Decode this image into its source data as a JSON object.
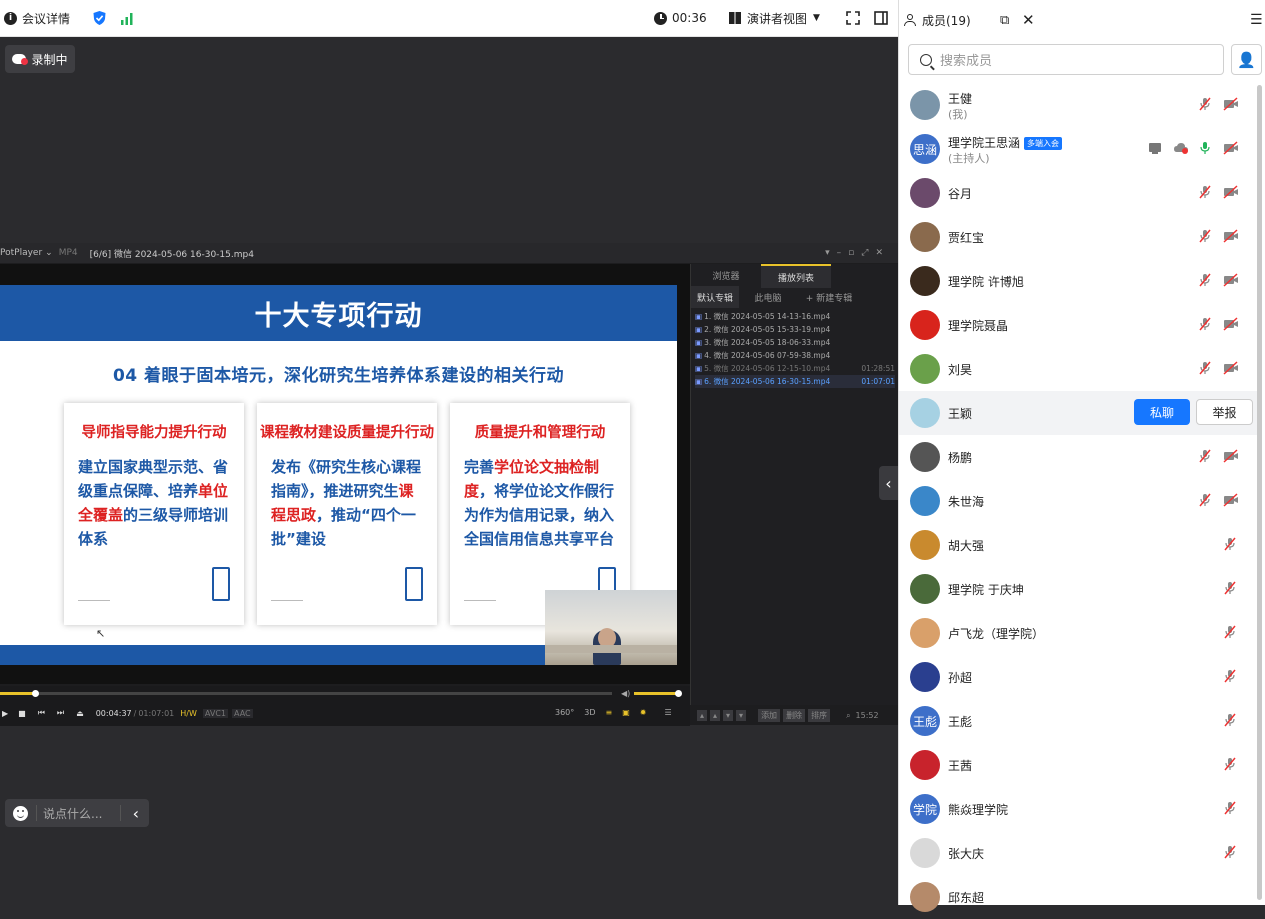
{
  "topbar": {
    "meeting_details": "会议详情",
    "timer": "00:36",
    "presenter_view": "演讲者视图"
  },
  "stage": {
    "recording": "录制中",
    "chat_placeholder": "说点什么..."
  },
  "player": {
    "app_name": "PotPlayer",
    "format": "MP4",
    "file_title": "[6/6] 微信 2024-05-06 16-30-15.mp4",
    "tabs": [
      "浏览器",
      "播放列表"
    ],
    "subtabs": [
      "默认专辑",
      "此电脑",
      "+ 新建专辑"
    ],
    "playlist": [
      {
        "name": "1. 微信 2024-05-05 14-13-16.mp4",
        "duration": ""
      },
      {
        "name": "2. 微信 2024-05-05 15-33-19.mp4",
        "duration": ""
      },
      {
        "name": "3. 微信 2024-05-05 18-06-33.mp4",
        "duration": ""
      },
      {
        "name": "4. 微信 2024-05-06 07-59-38.mp4",
        "duration": ""
      },
      {
        "name": "5. 微信 2024-05-06 12-15-10.mp4",
        "duration": "01:28:51"
      },
      {
        "name": "6. 微信 2024-05-06 16-30-15.mp4",
        "duration": "01:07:01"
      }
    ],
    "time_current": "00:04:37",
    "time_total": "01:07:01",
    "codec_tags": [
      "H/W",
      "AVC1",
      "AAC"
    ],
    "extra_tags": [
      "360°",
      "3D"
    ],
    "pl_buttons": [
      "添加",
      "删除",
      "排序"
    ],
    "clock": "15:52",
    "progress_fraction": 0.057
  },
  "slide": {
    "title": "十大专项行动",
    "subtitle": "04 着眼于固本培元，深化研究生培养体系建设的相关行动",
    "cards": [
      {
        "title": "导师指导能力提升行动",
        "body_a": "建立国家典型示范、省级重点保障、培养",
        "body_hl": "单位全覆盖",
        "body_b": "的三级导师培训体系"
      },
      {
        "title": "课程教材建设质量提升行动",
        "body_a": "发布《研究生核心课程指南》，推进研究生",
        "body_hl": "课程思政",
        "body_b": "，推动“四个一批”建设"
      },
      {
        "title": "质量提升和管理行动",
        "body_a": "完善",
        "body_hl": "学位论文抽检制度",
        "body_b": "，将学位论文作假行为作为信用记录，纳入全国信用信息共享平台"
      }
    ]
  },
  "side": {
    "title": "成员(19)",
    "search_placeholder": "搜索成员",
    "private_chat": "私聊",
    "report": "举报",
    "members": [
      {
        "name": "王健",
        "sub": "(我)",
        "avatar_text": "",
        "avatar_color": "#7b95a9",
        "icons": [
          "mic-off",
          "cam-off"
        ]
      },
      {
        "name": "理学院王思涵",
        "sub": "(主持人)",
        "badge": "多端入会",
        "avatar_text": "思涵",
        "avatar_color": "#3d6fc9",
        "icons": [
          "screen",
          "cloud",
          "mic-on",
          "cam-off"
        ]
      },
      {
        "name": "谷月",
        "sub": "",
        "avatar_text": "",
        "avatar_color": "#6b4a6b",
        "icons": [
          "mic-off",
          "cam-off"
        ]
      },
      {
        "name": "贾红宝",
        "sub": "",
        "avatar_text": "",
        "avatar_color": "#8a6a4d",
        "icons": [
          "mic-off",
          "cam-off"
        ]
      },
      {
        "name": "理学院 许博旭",
        "sub": "",
        "avatar_text": "",
        "avatar_color": "#3a2a1d",
        "icons": [
          "mic-off",
          "cam-off"
        ]
      },
      {
        "name": "理学院聂晶",
        "sub": "",
        "avatar_text": "",
        "avatar_color": "#d8241c",
        "icons": [
          "mic-off",
          "cam-off"
        ]
      },
      {
        "name": "刘昊",
        "sub": "",
        "avatar_text": "",
        "avatar_color": "#6aa04a",
        "icons": [
          "mic-off",
          "cam-off"
        ]
      },
      {
        "name": "王颖",
        "sub": "",
        "avatar_text": "",
        "avatar_color": "#a6d1e3",
        "icons": [],
        "hover": true
      },
      {
        "name": "杨鹏",
        "sub": "",
        "avatar_text": "",
        "avatar_color": "#555555",
        "icons": [
          "mic-off",
          "cam-off"
        ]
      },
      {
        "name": "朱世海",
        "sub": "",
        "avatar_text": "",
        "avatar_color": "#3a87c9",
        "icons": [
          "mic-off",
          "cam-off"
        ]
      },
      {
        "name": "胡大强",
        "sub": "",
        "avatar_text": "",
        "avatar_color": "#c98a2e",
        "icons": [
          "mic-off"
        ]
      },
      {
        "name": "理学院 于庆坤",
        "sub": "",
        "avatar_text": "",
        "avatar_color": "#4a6a3a",
        "icons": [
          "mic-off"
        ]
      },
      {
        "name": "卢飞龙（理学院）",
        "sub": "",
        "avatar_text": "",
        "avatar_color": "#d9a06a",
        "icons": [
          "mic-off"
        ]
      },
      {
        "name": "孙超",
        "sub": "",
        "avatar_text": "",
        "avatar_color": "#2a3f8f",
        "icons": [
          "mic-off"
        ]
      },
      {
        "name": "王彪",
        "sub": "",
        "avatar_text": "王彪",
        "avatar_color": "#3d6fc9",
        "icons": [
          "mic-off"
        ]
      },
      {
        "name": "王茜",
        "sub": "",
        "avatar_text": "",
        "avatar_color": "#c8232c",
        "icons": [
          "mic-off"
        ]
      },
      {
        "name": "熊焱理学院",
        "sub": "",
        "avatar_text": "学院",
        "avatar_color": "#3d6fc9",
        "icons": [
          "mic-off"
        ]
      },
      {
        "name": "张大庆",
        "sub": "",
        "avatar_text": "",
        "avatar_color": "#d9d9d9",
        "icons": [
          "mic-off"
        ]
      },
      {
        "name": "邱东超",
        "sub": "",
        "avatar_text": "",
        "avatar_color": "#b58a6a",
        "icons": []
      }
    ]
  },
  "colors": {
    "accent": "#1677ff",
    "slide_blue": "#1d58a6",
    "slide_red": "#d22222"
  }
}
